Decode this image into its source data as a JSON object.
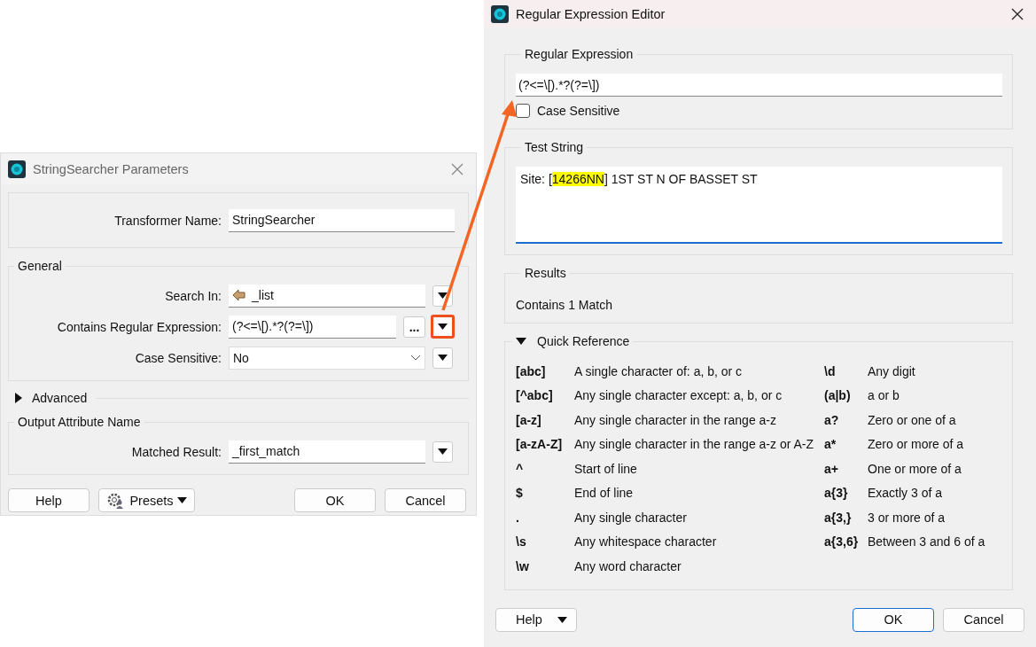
{
  "parameters_dialog": {
    "title": "StringSearcher Parameters",
    "transformer_name": {
      "label": "Transformer Name:",
      "value": "StringSearcher"
    },
    "general": {
      "title": "General",
      "rows": [
        {
          "label": "Search In:",
          "value": "_list",
          "kind": "attribute",
          "has_browse": false,
          "highlighted": false
        },
        {
          "label": "Contains Regular Expression:",
          "value": "(?<=\\[).*?(?=\\])",
          "kind": "text",
          "has_browse": true,
          "browse_label": "...",
          "highlighted": true
        },
        {
          "label": "Case Sensitive:",
          "value": "No",
          "kind": "combo",
          "has_browse": false,
          "highlighted": false
        }
      ]
    },
    "advanced": {
      "label": "Advanced",
      "expanded": false
    },
    "output": {
      "title": "Output Attribute Name",
      "rows": [
        {
          "label": "Matched Result:",
          "value": "_first_match",
          "kind": "text",
          "has_browse": false,
          "highlighted": false
        }
      ]
    },
    "buttons": {
      "help": "Help",
      "presets": "Presets",
      "ok": "OK",
      "cancel": "Cancel"
    }
  },
  "regex_editor": {
    "title": "Regular Expression Editor",
    "regex": {
      "title": "Regular Expression",
      "value": "(?<=\\[).*?(?=\\])",
      "case_sensitive": {
        "label": "Case Sensitive",
        "checked": false
      }
    },
    "test_string": {
      "title": "Test String",
      "segments": [
        {
          "text": "Site: [",
          "highlighted": false
        },
        {
          "text": "14266NN",
          "highlighted": true
        },
        {
          "text": "] 1ST ST N OF BASSET ST",
          "highlighted": false
        }
      ]
    },
    "results": {
      "title": "Results",
      "text": "Contains 1 Match"
    },
    "quick_reference": {
      "title": "Quick Reference",
      "expanded": true,
      "columns": [
        [
          {
            "token": "[abc]",
            "description": "A single character of: a, b, or c"
          },
          {
            "token": "[^abc]",
            "description": "Any single character except: a, b, or c"
          },
          {
            "token": "[a-z]",
            "description": "Any single character in the range a-z"
          },
          {
            "token": "[a-zA-Z]",
            "description": "Any single character in the range a-z or A-Z"
          },
          {
            "token": "^",
            "description": "Start of line"
          },
          {
            "token": "$",
            "description": "End of line"
          },
          {
            "token": ".",
            "description": "Any single character"
          },
          {
            "token": "\\s",
            "description": "Any whitespace character"
          },
          {
            "token": "\\w",
            "description": "Any word character"
          }
        ],
        [
          {
            "token": "\\d",
            "description": "Any digit"
          },
          {
            "token": "(a|b)",
            "description": "a or b"
          },
          {
            "token": "a?",
            "description": "Zero or one of a"
          },
          {
            "token": "a*",
            "description": "Zero or more of a"
          },
          {
            "token": "a+",
            "description": "One or more of a"
          },
          {
            "token": "a{3}",
            "description": "Exactly 3 of a"
          },
          {
            "token": "a{3,}",
            "description": "3 or more of a"
          },
          {
            "token": "a{3,6}",
            "description": "Between 3 and 6 of a"
          }
        ]
      ]
    },
    "buttons": {
      "help": "Help",
      "ok": "OK",
      "cancel": "Cancel"
    }
  }
}
